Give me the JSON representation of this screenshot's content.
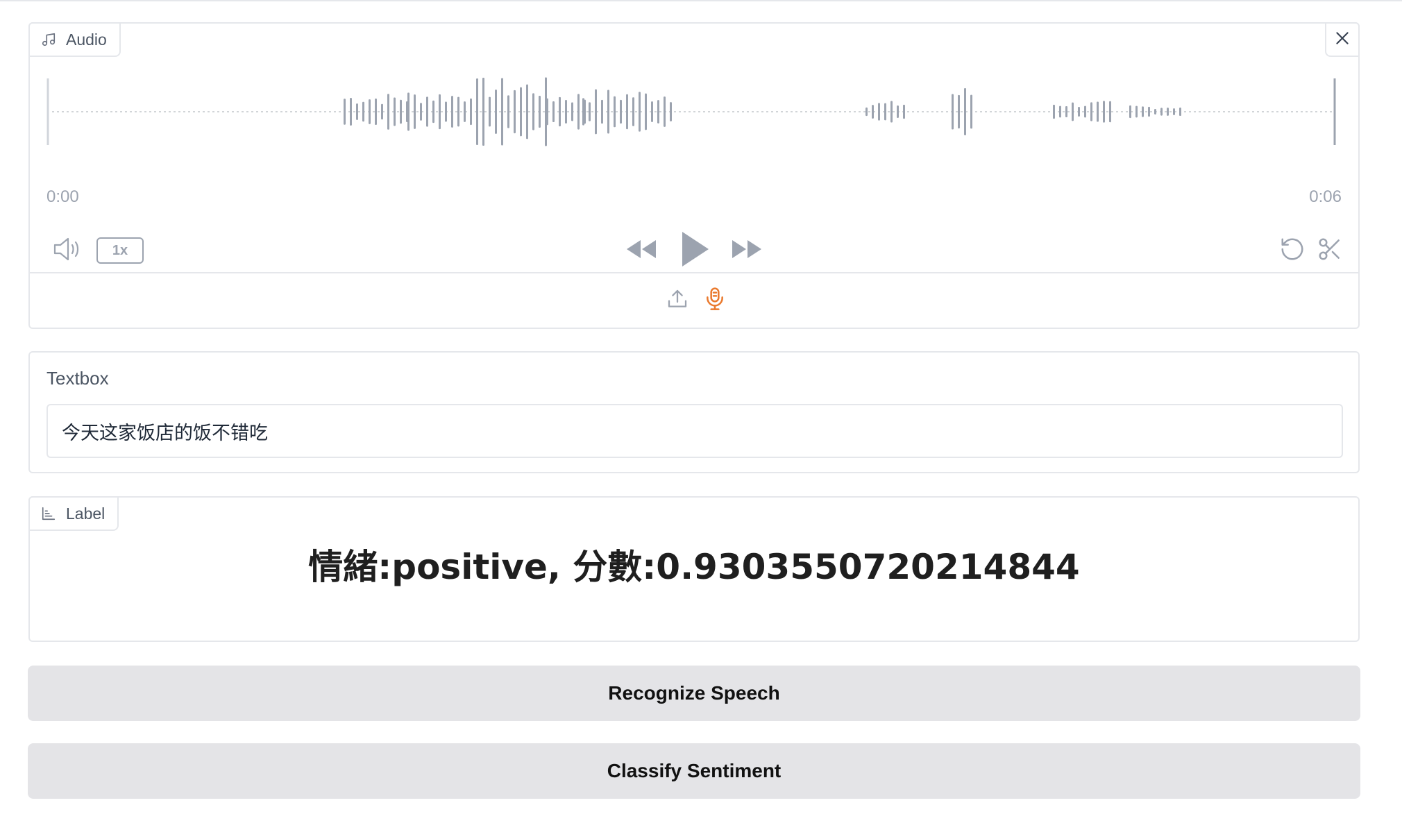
{
  "audio": {
    "tag_label": "Audio",
    "time_start": "0:00",
    "time_end": "0:06",
    "playback_rate": "1x"
  },
  "textbox": {
    "label": "Textbox",
    "value": "今天这家饭店的饭不错吃"
  },
  "label_output": {
    "tag_label": "Label",
    "value": "情緒:positive, 分數:0.9303550720214844"
  },
  "buttons": {
    "recognize": "Recognize Speech",
    "classify": "Classify Sentiment"
  },
  "colors": {
    "border": "#e5e7eb",
    "icon_gray": "#9ca3af",
    "mic_accent": "#ea7a2e",
    "button_bg": "#e4e4e7"
  },
  "icons": {
    "audio_tag": "music-note-icon",
    "label_tag": "bar-chart-icon",
    "close": "close-icon",
    "volume": "volume-icon",
    "rewind": "rewind-icon",
    "play": "play-icon",
    "forward": "fast-forward-icon",
    "undo": "undo-icon",
    "trim": "scissors-icon",
    "upload": "upload-icon",
    "microphone": "microphone-icon"
  }
}
